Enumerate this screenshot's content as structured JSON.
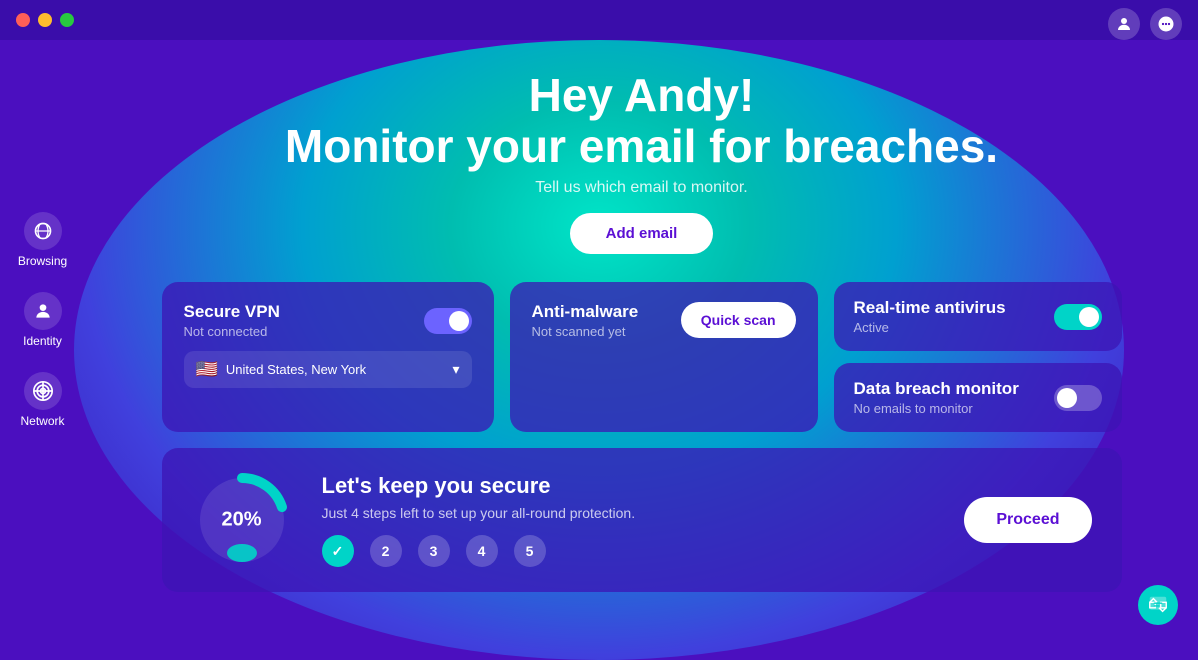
{
  "titlebar": {
    "lights": [
      "red",
      "yellow",
      "green"
    ]
  },
  "topRight": {
    "userIcon": "👤",
    "chatIcon": "💬"
  },
  "sidebar": {
    "items": [
      {
        "id": "browsing",
        "label": "Browsing",
        "icon": "🖱️"
      },
      {
        "id": "identity",
        "label": "Identity",
        "icon": "👤"
      },
      {
        "id": "network",
        "label": "Network",
        "icon": "🌐"
      }
    ]
  },
  "hero": {
    "title": "Hey Andy!",
    "title2": "Monitor your email for breaches.",
    "subtitle": "Tell us which email to monitor.",
    "addEmailBtn": "Add email"
  },
  "vpnCard": {
    "title": "Secure VPN",
    "status": "Not connected",
    "toggleState": "on",
    "location": "United States, New York",
    "flag": "🇺🇸"
  },
  "antiMalwareCard": {
    "title": "Anti-malware",
    "status": "Not scanned yet",
    "quickScanBtn": "Quick scan"
  },
  "rightCards": {
    "antivirus": {
      "title": "Real-time antivirus",
      "status": "Active",
      "toggleState": "on-teal"
    },
    "breach": {
      "title": "Data breach monitor",
      "status": "No emails to monitor",
      "toggleState": "off"
    }
  },
  "progressCard": {
    "percent": "20%",
    "title": "Let's keep you secure",
    "desc": "Just 4 steps left to set up your all-round protection.",
    "steps": [
      {
        "label": "✓",
        "done": true
      },
      {
        "label": "2",
        "done": false
      },
      {
        "label": "3",
        "done": false
      },
      {
        "label": "4",
        "done": false
      },
      {
        "label": "5",
        "done": false
      }
    ],
    "proceedBtn": "Proceed"
  },
  "chatFab": "📣"
}
